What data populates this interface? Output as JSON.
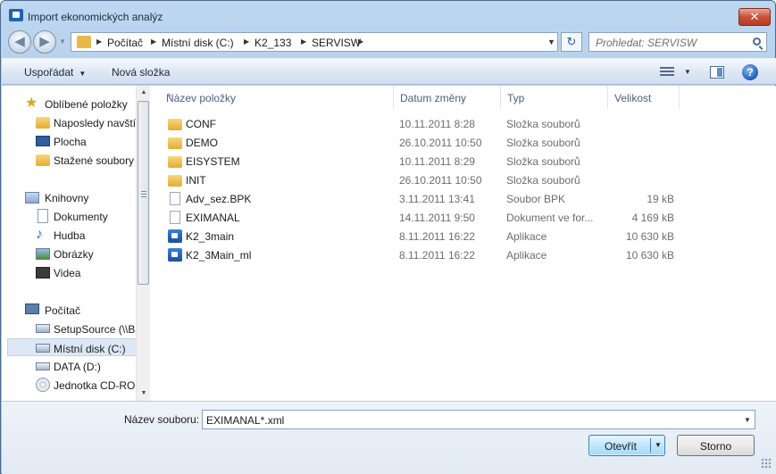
{
  "window": {
    "title": "Import ekonomických analýz",
    "close_glyph": "✕"
  },
  "navigation": {
    "back_glyph": "◀",
    "forward_glyph": "▶",
    "recent_glyph": "▼",
    "breadcrumbs": [
      "Počítač",
      "Místní disk (C:)",
      "K2_133",
      "SERVISW"
    ],
    "separator_glyph": "▶",
    "dropdown_glyph": "▼",
    "refresh_glyph": "↻",
    "search_placeholder": "Prohledat: SERVISW"
  },
  "toolbar": {
    "organize_label": "Uspořádat",
    "organize_arrow": "▼",
    "new_folder_label": "Nová složka",
    "views_arrow": "▼",
    "help_glyph": "?"
  },
  "nav_pane": {
    "items": [
      {
        "label": "Oblíbené položky",
        "icon": "star-icon"
      },
      {
        "label": "Naposledy navštívené",
        "icon": "recent-folder-icon"
      },
      {
        "label": "Plocha",
        "icon": "desktop-icon"
      },
      {
        "label": "Stažené soubory",
        "icon": "downloads-icon"
      },
      {
        "label": "Knihovny",
        "icon": "libraries-icon"
      },
      {
        "label": "Dokumenty",
        "icon": "documents-icon"
      },
      {
        "label": "Hudba",
        "icon": "music-icon"
      },
      {
        "label": "Obrázky",
        "icon": "pictures-icon"
      },
      {
        "label": "Videa",
        "icon": "videos-icon"
      },
      {
        "label": "Počítač",
        "icon": "computer-icon"
      },
      {
        "label": "SetupSource (\\\\B",
        "icon": "network-drive-icon"
      },
      {
        "label": "Místní disk (C:)",
        "icon": "system-drive-icon",
        "selected": true
      },
      {
        "label": "DATA (D:)",
        "icon": "drive-icon"
      },
      {
        "label": "Jednotka CD-ROM",
        "icon": "cd-drive-icon"
      }
    ],
    "music_glyph": "♪",
    "star_glyph": "★",
    "scroll_up_glyph": "▲",
    "scroll_down_glyph": "▼"
  },
  "filelist": {
    "columns": [
      "Název položky",
      "Datum změny",
      "Typ",
      "Velikost"
    ],
    "sort_glyph": "▲",
    "rows": [
      {
        "name": "CONF",
        "date": "10.11.2011 8:28",
        "type": "Složka souborů",
        "size": "",
        "icon": "folder-icon"
      },
      {
        "name": "DEMO",
        "date": "26.10.2011 10:50",
        "type": "Složka souborů",
        "size": "",
        "icon": "folder-icon"
      },
      {
        "name": "EISYSTEM",
        "date": "10.11.2011 8:29",
        "type": "Složka souborů",
        "size": "",
        "icon": "folder-icon"
      },
      {
        "name": "INIT",
        "date": "26.10.2011 10:50",
        "type": "Složka souborů",
        "size": "",
        "icon": "folder-icon"
      },
      {
        "name": "Adv_sez.BPK",
        "date": "3.11.2011 13:41",
        "type": "Soubor BPK",
        "size": "19 kB",
        "icon": "file-icon"
      },
      {
        "name": "EXIMANAL",
        "date": "14.11.2011 9:50",
        "type": "Dokument ve for...",
        "size": "4 169 kB",
        "icon": "file-icon"
      },
      {
        "name": "K2_3main",
        "date": "8.11.2011 16:22",
        "type": "Aplikace",
        "size": "10 630 kB",
        "icon": "application-icon"
      },
      {
        "name": "K2_3Main_ml",
        "date": "8.11.2011 16:22",
        "type": "Aplikace",
        "size": "10 630 kB",
        "icon": "application-icon"
      }
    ]
  },
  "footer": {
    "filename_label": "Název souboru:",
    "filename_value": "EXIMANAL*.xml",
    "filename_dropdown_glyph": "▼",
    "open_label": "Otevřít",
    "open_arrow": "▼",
    "cancel_label": "Storno"
  }
}
